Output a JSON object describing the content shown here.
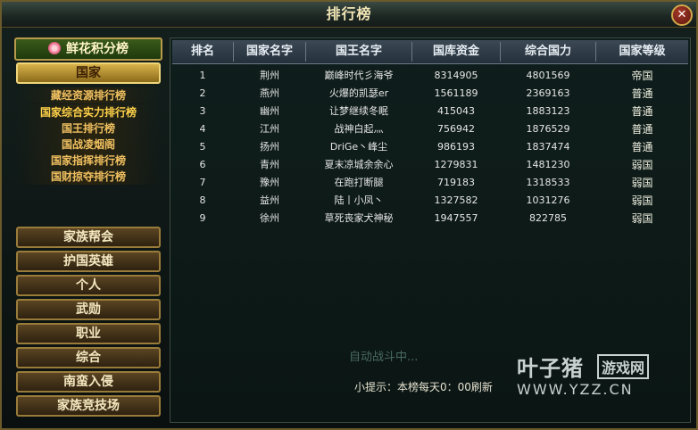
{
  "window": {
    "title": "排行榜",
    "close": "✕"
  },
  "sidebar": {
    "header": "鲜花积分榜",
    "category": "国家",
    "subitems": [
      "藏经资源排行榜",
      "国家综合实力排行榜",
      "国王排行榜",
      "国战凌烟阁",
      "国家指挥排行榜",
      "国财掠夺排行榜"
    ],
    "buttons": [
      "家族帮会",
      "护国英雄",
      "个人",
      "武勋",
      "职业",
      "综合",
      "南蛮入侵",
      "家族竞技场"
    ]
  },
  "table": {
    "headers": [
      "排名",
      "国家名字",
      "国王名字",
      "国库资金",
      "综合国力",
      "国家等级"
    ],
    "rows": [
      [
        "1",
        "荆州",
        "巅峰时代彡海爷",
        "8314905",
        "4801569",
        "帝国"
      ],
      [
        "2",
        "燕州",
        "火爆的凯瑟er",
        "1561189",
        "2369163",
        "普通"
      ],
      [
        "3",
        "幽州",
        "让梦继续冬眠",
        "415043",
        "1883123",
        "普通"
      ],
      [
        "4",
        "江州",
        "战神白起灬",
        "756942",
        "1876529",
        "普通"
      ],
      [
        "5",
        "扬州",
        "DriGe丶峰尘",
        "986193",
        "1837474",
        "普通"
      ],
      [
        "6",
        "青州",
        "夏末凉城余余心",
        "1279831",
        "1481230",
        "弱国"
      ],
      [
        "7",
        "豫州",
        "在跑打断腿",
        "719183",
        "1318533",
        "弱国"
      ],
      [
        "8",
        "益州",
        "陆丨小凤丶",
        "1327582",
        "1031276",
        "弱国"
      ],
      [
        "9",
        "徐州",
        "草死丧家犬神秘",
        "1947557",
        "822785",
        "弱国"
      ]
    ]
  },
  "status": {
    "auto": "自动战斗中..."
  },
  "hint": "小提示：本榜每天0：00刷新",
  "brand": {
    "name": "叶子猪",
    "tag": "游戏网",
    "url": "WWW.YZZ.CN"
  }
}
